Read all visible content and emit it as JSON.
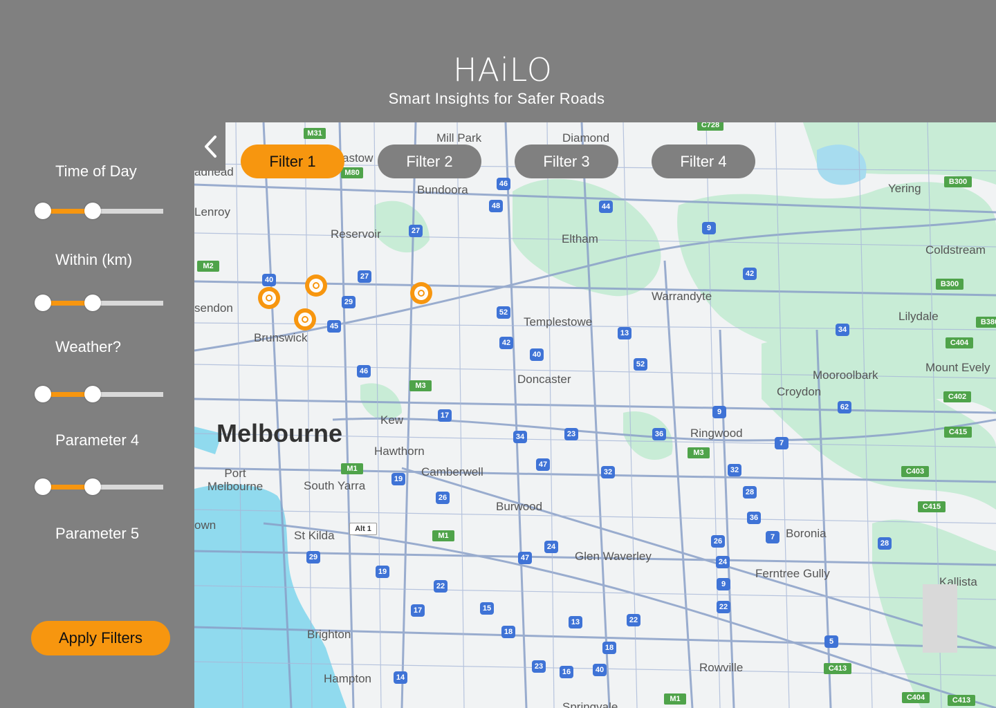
{
  "header": {
    "title": "HAiLO",
    "subtitle": "Smart Insights for Safer Roads"
  },
  "sidebar": {
    "filters": [
      {
        "label": "Time of Day",
        "range": [
          0,
          0.39
        ]
      },
      {
        "label": "Within (km)",
        "range": [
          0,
          0.39
        ]
      },
      {
        "label": "Weather?",
        "range": [
          0,
          0.39
        ]
      },
      {
        "label": "Parameter 4",
        "range": [
          0,
          0.39
        ]
      },
      {
        "label": "Parameter 5"
      }
    ],
    "apply_label": "Apply Filters"
  },
  "filter_tabs": [
    {
      "label": "Filter 1",
      "active": true
    },
    {
      "label": "Filter 2",
      "active": false
    },
    {
      "label": "Filter 3",
      "active": false
    },
    {
      "label": "Filter 4",
      "active": false
    }
  ],
  "map": {
    "places": [
      "Melbourne",
      "Mill Park",
      "Diamond",
      "Bundoora",
      "Yering",
      "Coldstream",
      "Reservoir",
      "Eltham",
      "Warrandyte",
      "Lilydale",
      "Templestowe",
      "Brunswick",
      "Doncaster",
      "Mooroolbark",
      "Croydon",
      "Mount Evely",
      "Kew",
      "Ringwood",
      "Hawthorn",
      "Camberwell",
      "Port Melbourne",
      "South Yarra",
      "Burwood",
      "St Kilda",
      "Boronia",
      "Glen Waverley",
      "Ferntree Gully",
      "Kallista",
      "Brighton",
      "Hampton",
      "Rowville",
      "Lenroy",
      "sendon",
      "own",
      "adhead",
      "astow",
      "Springvale"
    ],
    "route_shields": [
      "46",
      "48",
      "44",
      "27",
      "9",
      "40",
      "29",
      "27",
      "42",
      "45",
      "52",
      "13",
      "34",
      "42",
      "40",
      "52",
      "46",
      "9",
      "62",
      "17",
      "34",
      "23",
      "36",
      "7",
      "47",
      "32",
      "32",
      "28",
      "19",
      "26",
      "36",
      "7",
      "28",
      "47",
      "24",
      "26",
      "24",
      "29",
      "19",
      "9",
      "22",
      "22",
      "17",
      "15",
      "18",
      "13",
      "22",
      "5",
      "23",
      "16",
      "40",
      "14",
      "18"
    ],
    "freeway_shields": [
      "M31",
      "M80",
      "M2",
      "M3",
      "M3",
      "M1",
      "M1",
      "Alt 1",
      "C728",
      "B300",
      "B300",
      "B380",
      "C404",
      "C402",
      "C415",
      "C403",
      "C415",
      "C413",
      "C404",
      "C413",
      "M1"
    ],
    "accident_markers": 4
  },
  "colors": {
    "accent": "#f7960f",
    "panel": "#808080",
    "water": "#90daee",
    "park": "#c8ecd6",
    "road": "#8aa0c8"
  }
}
